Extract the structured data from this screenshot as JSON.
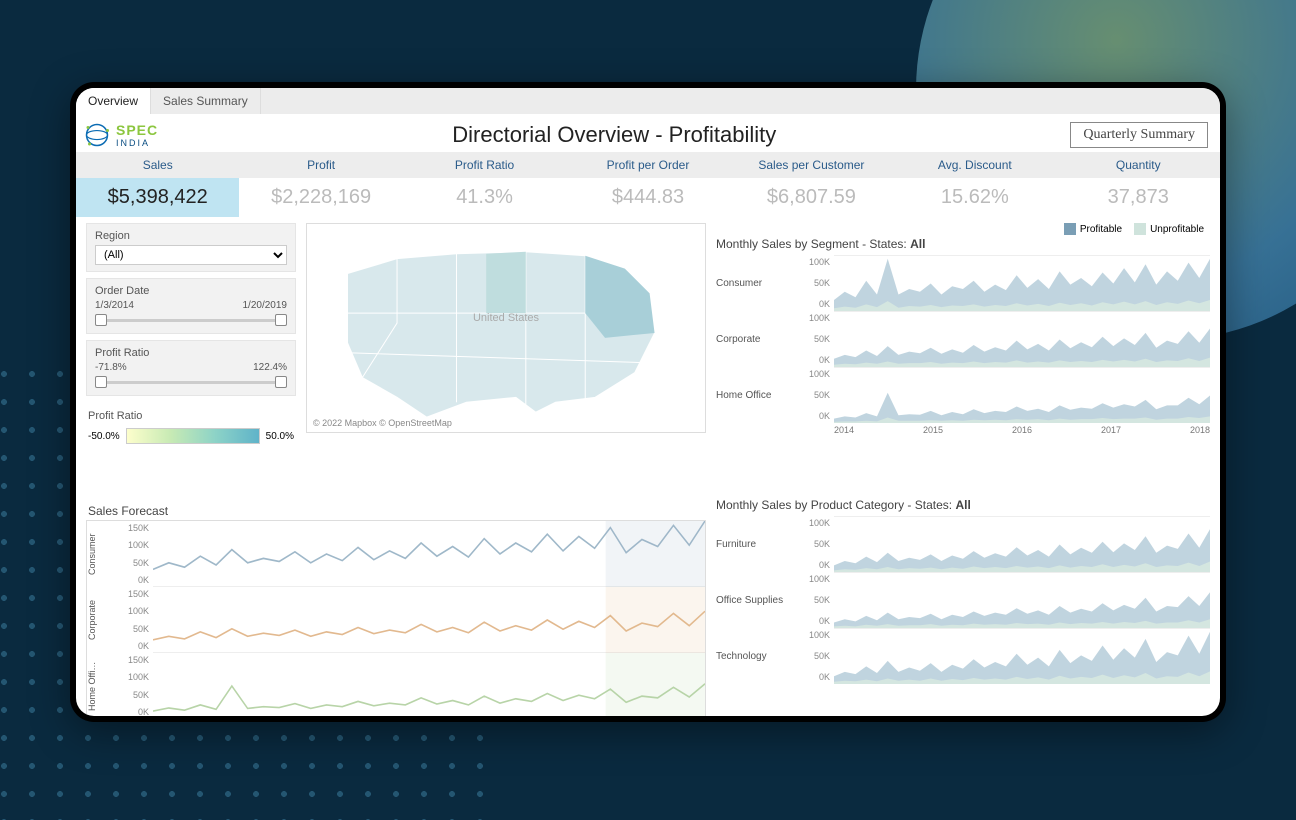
{
  "tabs": {
    "overview": "Overview",
    "sales_summary": "Sales Summary"
  },
  "logo": {
    "brand": "SPEC",
    "sub": "INDIA"
  },
  "title": "Directorial Overview - Profitability",
  "quarterly_btn": "Quarterly Summary",
  "kpi_labels": {
    "sales": "Sales",
    "profit": "Profit",
    "pr": "Profit Ratio",
    "ppo": "Profit per Order",
    "spc": "Sales per Customer",
    "disc": "Avg. Discount",
    "qty": "Quantity"
  },
  "kpi_values": {
    "sales": "$5,398,422",
    "profit": "$2,228,169",
    "pr": "41.3%",
    "ppo": "$444.83",
    "spc": "$6,807.59",
    "disc": "15.62%",
    "qty": "37,873"
  },
  "filters": {
    "region_label": "Region",
    "region_value": "(All)",
    "order_date_label": "Order Date",
    "od_min": "1/3/2014",
    "od_max": "1/20/2019",
    "profit_ratio_label": "Profit Ratio",
    "pr_min": "-71.8%",
    "pr_max": "122.4%",
    "pr_legend_label": "Profit Ratio",
    "pr_legend_min": "-50.0%",
    "pr_legend_max": "50.0%"
  },
  "map": {
    "label": "United\nStates",
    "attr": "© 2022 Mapbox © OpenStreetMap"
  },
  "legend": {
    "profitable": "Profitable",
    "unprofitable": "Unprofitable"
  },
  "seg_title_prefix": "Monthly Sales by Segment - States: ",
  "states_all": "All",
  "cat_title_prefix": "Monthly Sales by Product Category - States: ",
  "forecast_title": "Sales Forecast",
  "y_ticks_small": [
    "100K",
    "50K",
    "0K"
  ],
  "y_ticks_forecast": [
    "150K",
    "100K",
    "50K",
    "0K"
  ],
  "x_years": [
    "2014",
    "2015",
    "2016",
    "2017",
    "2018"
  ],
  "segments": [
    "Consumer",
    "Corporate",
    "Home Office"
  ],
  "categories": [
    "Furniture",
    "Office Supplies",
    "Technology"
  ],
  "chart_data": {
    "monthly_segment": {
      "type": "area",
      "x_years": [
        2014,
        2015,
        2016,
        2017,
        2018
      ],
      "ylim": [
        0,
        100
      ],
      "series_note": "values approximate (K)",
      "Consumer": {
        "profitable": [
          20,
          35,
          25,
          55,
          30,
          95,
          30,
          40,
          35,
          50,
          30,
          45,
          40,
          55,
          35,
          48,
          38,
          65,
          42,
          58,
          40,
          72,
          48,
          60,
          45,
          70,
          50,
          78,
          52,
          85,
          48,
          72,
          55,
          88,
          60,
          95
        ],
        "unprofitable": [
          5,
          8,
          6,
          12,
          7,
          18,
          6,
          9,
          8,
          11,
          7,
          10,
          9,
          12,
          8,
          11,
          9,
          14,
          10,
          13,
          9,
          15,
          11,
          14,
          10,
          16,
          12,
          17,
          12,
          18,
          11,
          16,
          13,
          19,
          14,
          20
        ]
      },
      "Corporate": {
        "profitable": [
          15,
          22,
          18,
          30,
          20,
          38,
          22,
          28,
          25,
          35,
          24,
          32,
          26,
          40,
          28,
          36,
          30,
          48,
          32,
          42,
          30,
          50,
          34,
          45,
          36,
          55,
          38,
          52,
          40,
          62,
          35,
          48,
          42,
          65,
          44,
          70
        ],
        "unprofitable": [
          4,
          6,
          5,
          8,
          6,
          10,
          6,
          7,
          7,
          9,
          6,
          8,
          7,
          10,
          7,
          9,
          8,
          12,
          8,
          10,
          8,
          12,
          9,
          11,
          9,
          13,
          10,
          13,
          10,
          15,
          9,
          12,
          11,
          16,
          11,
          17
        ]
      },
      "Home Office": {
        "profitable": [
          8,
          12,
          10,
          18,
          12,
          55,
          14,
          16,
          15,
          22,
          14,
          20,
          16,
          25,
          18,
          22,
          20,
          30,
          22,
          26,
          20,
          32,
          24,
          28,
          26,
          36,
          28,
          34,
          30,
          42,
          25,
          32,
          32,
          46,
          34,
          50
        ],
        "unprofitable": [
          2,
          3,
          3,
          4,
          3,
          10,
          4,
          4,
          4,
          5,
          4,
          5,
          4,
          6,
          5,
          6,
          5,
          7,
          6,
          7,
          5,
          8,
          6,
          7,
          7,
          9,
          7,
          8,
          8,
          10,
          6,
          8,
          8,
          11,
          9,
          12
        ]
      }
    },
    "monthly_category": {
      "type": "area",
      "x_years": [
        2014,
        2015,
        2016,
        2017,
        2018
      ],
      "ylim": [
        0,
        100
      ],
      "Furniture": {
        "profitable": [
          12,
          20,
          16,
          28,
          18,
          35,
          20,
          26,
          22,
          32,
          20,
          30,
          24,
          38,
          26,
          34,
          28,
          45,
          30,
          40,
          28,
          50,
          32,
          44,
          35,
          55,
          36,
          52,
          40,
          65,
          35,
          48,
          42,
          70,
          44,
          78
        ],
        "unprofitable": [
          3,
          5,
          4,
          7,
          5,
          9,
          5,
          7,
          6,
          8,
          5,
          8,
          6,
          10,
          7,
          9,
          7,
          11,
          8,
          10,
          7,
          12,
          8,
          11,
          9,
          14,
          9,
          13,
          10,
          16,
          9,
          12,
          11,
          17,
          11,
          19
        ]
      },
      "Office Supplies": {
        "profitable": [
          10,
          16,
          12,
          22,
          14,
          28,
          16,
          20,
          18,
          26,
          16,
          24,
          20,
          30,
          22,
          28,
          24,
          36,
          26,
          32,
          24,
          40,
          28,
          35,
          30,
          45,
          32,
          42,
          35,
          55,
          30,
          40,
          38,
          58,
          40,
          65
        ],
        "unprofitable": [
          3,
          4,
          3,
          6,
          4,
          7,
          4,
          5,
          5,
          7,
          4,
          6,
          5,
          8,
          6,
          7,
          6,
          9,
          7,
          8,
          6,
          10,
          7,
          9,
          8,
          11,
          8,
          11,
          9,
          13,
          8,
          10,
          10,
          14,
          10,
          16
        ]
      },
      "Technology": {
        "profitable": [
          14,
          22,
          18,
          32,
          20,
          42,
          22,
          30,
          24,
          38,
          22,
          35,
          28,
          45,
          30,
          40,
          32,
          55,
          35,
          48,
          32,
          62,
          38,
          52,
          42,
          70,
          44,
          65,
          48,
          82,
          40,
          58,
          52,
          88,
          55,
          95
        ],
        "unprofitable": [
          4,
          6,
          5,
          8,
          5,
          10,
          6,
          8,
          6,
          10,
          6,
          9,
          7,
          11,
          8,
          10,
          8,
          13,
          9,
          12,
          8,
          15,
          10,
          13,
          11,
          17,
          11,
          16,
          12,
          20,
          10,
          14,
          13,
          21,
          14,
          23
        ]
      }
    },
    "forecast": {
      "type": "line",
      "ylim": [
        0,
        150
      ],
      "Consumer": [
        40,
        55,
        45,
        70,
        50,
        85,
        55,
        65,
        58,
        80,
        55,
        75,
        60,
        90,
        62,
        82,
        65,
        100,
        70,
        92,
        68,
        110,
        75,
        100,
        80,
        120,
        82,
        115,
        88,
        135,
        78,
        108,
        92,
        140,
        95,
        150
      ],
      "Corporate": [
        30,
        38,
        32,
        48,
        35,
        55,
        38,
        45,
        40,
        52,
        38,
        48,
        42,
        58,
        44,
        52,
        46,
        65,
        48,
        58,
        46,
        70,
        50,
        62,
        52,
        75,
        54,
        72,
        58,
        85,
        50,
        68,
        60,
        90,
        62,
        95
      ],
      "Home Office": [
        18,
        25,
        20,
        32,
        22,
        75,
        24,
        28,
        26,
        35,
        24,
        32,
        28,
        40,
        30,
        36,
        32,
        48,
        34,
        42,
        32,
        52,
        36,
        46,
        40,
        58,
        42,
        54,
        46,
        68,
        38,
        52,
        48,
        72,
        50,
        80
      ]
    }
  }
}
